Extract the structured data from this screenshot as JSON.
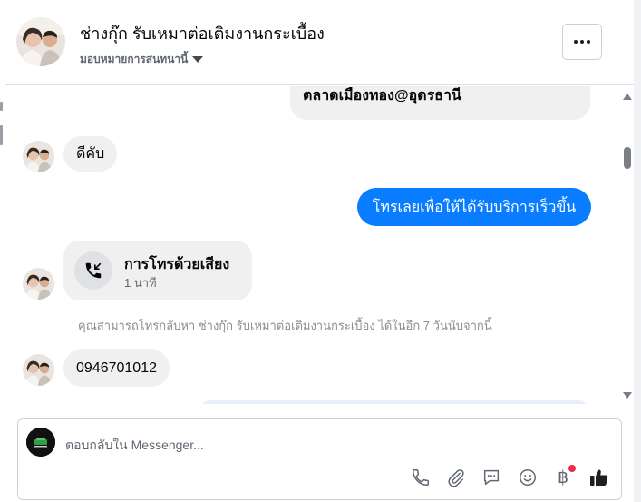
{
  "header": {
    "page_name": "ช่างกุ๊ก รับเหมาต่อเติมงานกระเบื้อง",
    "assign_label": "มอบหมายการสนทนานี้"
  },
  "messages": {
    "partial_top": "ตลาดเมืองทอง@อุดรธานี",
    "incoming_1": "ดีคับ",
    "outgoing_1": "โทรเลยเพื่อให้ได้รับบริการเร็วขึ้น",
    "call_title": "การโทรด้วยเสียง",
    "call_duration": "1 นาที",
    "callback_notice": "คุณสามารถโทรกลับหา ช่างกุ๊ก รับเหมาต่อเติมงานกระเบื้อง ได้ในอีก 7 วันนับจากนี้",
    "incoming_phone": "0946701012"
  },
  "composer": {
    "placeholder": "ตอบกลับใน Messenger...",
    "currency_symbol": "฿"
  },
  "icons": {
    "more": "more-options-icon",
    "call": "incoming-call-icon",
    "phone": "phone-icon",
    "attach": "paperclip-icon",
    "saved_replies": "chat-bubble-icon",
    "emoji": "emoji-icon",
    "payment": "baht-icon",
    "like": "thumbs-up-icon"
  },
  "colors": {
    "outgoing_bubble": "#0a7cff",
    "incoming_bubble": "#f0f0f0",
    "notification_dot": "#f02849"
  }
}
